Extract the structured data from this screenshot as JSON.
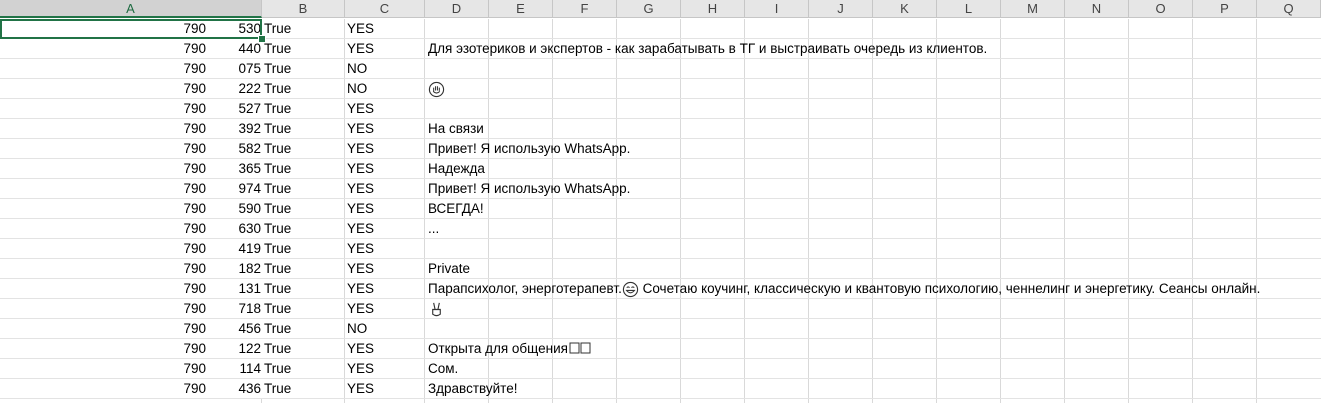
{
  "columns": [
    {
      "label": "A",
      "selected": true
    },
    {
      "label": "B",
      "selected": false
    },
    {
      "label": "C",
      "selected": false
    },
    {
      "label": "D",
      "selected": false
    },
    {
      "label": "E",
      "selected": false
    },
    {
      "label": "F",
      "selected": false
    },
    {
      "label": "G",
      "selected": false
    },
    {
      "label": "H",
      "selected": false
    },
    {
      "label": "I",
      "selected": false
    },
    {
      "label": "J",
      "selected": false
    },
    {
      "label": "K",
      "selected": false
    },
    {
      "label": "L",
      "selected": false
    },
    {
      "label": "M",
      "selected": false
    },
    {
      "label": "N",
      "selected": false
    },
    {
      "label": "O",
      "selected": false
    },
    {
      "label": "P",
      "selected": false
    },
    {
      "label": "Q",
      "selected": false
    }
  ],
  "rows": [
    {
      "a": "790",
      "a_tail": "530",
      "b": "True",
      "c": "YES",
      "d": ""
    },
    {
      "a": "790",
      "a_tail": "440",
      "b": "True",
      "c": "YES",
      "d": "Для эзотериков и экспертов - как зарабатывать в ТГ и выстраивать очередь из клиентов."
    },
    {
      "a": "790",
      "a_tail": "075",
      "b": "True",
      "c": "NO",
      "d": ""
    },
    {
      "a": "790",
      "a_tail": "222",
      "b": "True",
      "c": "NO",
      "d": "",
      "d_icon": "hand-emoji-icon"
    },
    {
      "a": "790",
      "a_tail": "527",
      "b": "True",
      "c": "YES",
      "d": ""
    },
    {
      "a": "790",
      "a_tail": "392",
      "b": "True",
      "c": "YES",
      "d": "На связи"
    },
    {
      "a": "790",
      "a_tail": "582",
      "b": "True",
      "c": "YES",
      "d": "Привет! Я использую WhatsApp."
    },
    {
      "a": "790",
      "a_tail": "365",
      "b": "True",
      "c": "YES",
      "d": "Надежда"
    },
    {
      "a": "790",
      "a_tail": "974",
      "b": "True",
      "c": "YES",
      "d": "Привет! Я использую WhatsApp."
    },
    {
      "a": "790",
      "a_tail": "590",
      "b": "True",
      "c": "YES",
      "d": "ВСЕГДА!"
    },
    {
      "a": "790",
      "a_tail": "630",
      "b": "True",
      "c": "YES",
      "d": "..."
    },
    {
      "a": "790",
      "a_tail": "419",
      "b": "True",
      "c": "YES",
      "d": ""
    },
    {
      "a": "790",
      "a_tail": "182",
      "b": "True",
      "c": "YES",
      "d": "Private"
    },
    {
      "a": "790",
      "a_tail": "131",
      "b": "True",
      "c": "YES",
      "d": "Парапсихолог, энерготерапевт.",
      "d_icon": "smiling-face-emoji-icon",
      "d_after": " Сочетаю коучинг, классическую и квантовую психологию, ченнелинг и энергетику. Сеансы онлайн."
    },
    {
      "a": "790",
      "a_tail": "718",
      "b": "True",
      "c": "YES",
      "d": "",
      "d_icon": "victory-hand-emoji-icon"
    },
    {
      "a": "790",
      "a_tail": "456",
      "b": "True",
      "c": "NO",
      "d": ""
    },
    {
      "a": "790",
      "a_tail": "122",
      "b": "True",
      "c": "YES",
      "d": "Открыта для общения",
      "d_icon": "missing-glyph-icon"
    },
    {
      "a": "790",
      "a_tail": "114",
      "b": "True",
      "c": "YES",
      "d": "Сом."
    },
    {
      "a": "790",
      "a_tail": "436",
      "b": "True",
      "c": "YES",
      "d": "Здравствуйте!"
    }
  ],
  "colors": {
    "accent": "#217346",
    "header_bg": "#e6e6e6",
    "grid": "#d9d9d9"
  }
}
